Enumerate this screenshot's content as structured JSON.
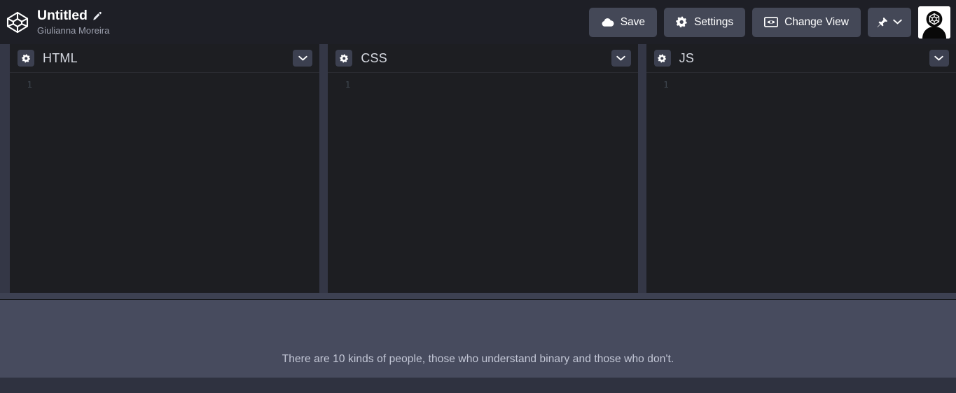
{
  "header": {
    "logo_icon": "codepen-logo-icon",
    "pen_title": "Untitled",
    "edit_icon": "pencil-icon",
    "author": "Giulianna Moreira",
    "buttons": [
      {
        "label": "Save",
        "icon": "cloud-icon",
        "name": "save-button"
      },
      {
        "label": "Settings",
        "icon": "gear-icon",
        "name": "settings-button"
      },
      {
        "label": "Change View",
        "icon": "eye-in-box-icon",
        "name": "change-view-button"
      }
    ],
    "pin_button": {
      "icon": "pin-icon",
      "chevron": "chevron-down-icon",
      "label": ""
    },
    "avatar_alt": "user-avatar"
  },
  "editors": [
    {
      "name": "html",
      "title": "HTML",
      "settings_icon": "gear-icon",
      "collapse_icon": "chevron-down-icon",
      "line_numbers": [
        "1"
      ],
      "code": [
        ""
      ]
    },
    {
      "name": "css",
      "title": "CSS",
      "settings_icon": "gear-icon",
      "collapse_icon": "chevron-down-icon",
      "line_numbers": [
        "1"
      ],
      "code": [
        ""
      ]
    },
    {
      "name": "js",
      "title": "JS",
      "settings_icon": "gear-icon",
      "collapse_icon": "chevron-down-icon",
      "line_numbers": [
        "1"
      ],
      "code": [
        ""
      ]
    }
  ],
  "preview": {
    "quote": "There are 10 kinds of people, those who understand binary and those who don't."
  },
  "colors": {
    "header_bg": "#1e1f26",
    "page_bg": "#343746",
    "editor_bg": "#1d1e22",
    "button_bg": "#444857",
    "icon_btn_bg": "#3c4050",
    "preview_bg": "#474b5e",
    "drag_handle": "#3d4152",
    "title_text": "#ffffff",
    "author_text": "#9ea2b0",
    "pane_title_text": "#d5d8e0",
    "line_number_text": "#3f4750",
    "quote_text": "#c3c7d6"
  }
}
